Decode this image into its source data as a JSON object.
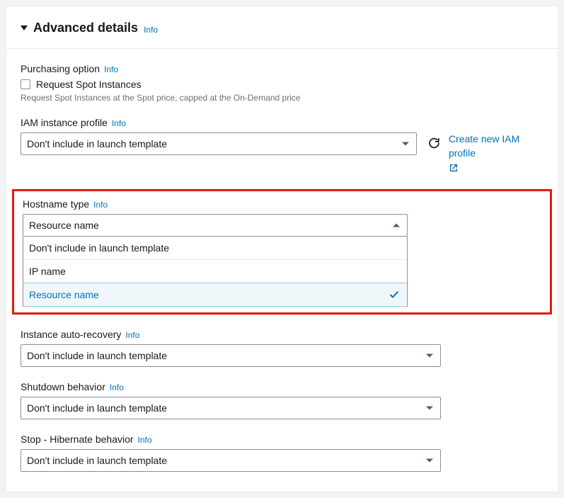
{
  "section": {
    "title": "Advanced details",
    "info": "Info"
  },
  "purchasing": {
    "label": "Purchasing option",
    "info": "Info",
    "checkbox_label": "Request Spot Instances",
    "helper": "Request Spot Instances at the Spot price, capped at the On-Demand price"
  },
  "iam": {
    "label": "IAM instance profile",
    "info": "Info",
    "value": "Don't include in launch template",
    "link": "Create new IAM profile"
  },
  "hostname": {
    "label": "Hostname type",
    "info": "Info",
    "value": "Resource name",
    "options": [
      "Don't include in launch template",
      "IP name",
      "Resource name"
    ]
  },
  "autorecovery": {
    "label": "Instance auto-recovery",
    "info": "Info",
    "value": "Don't include in launch template"
  },
  "shutdown": {
    "label": "Shutdown behavior",
    "info": "Info",
    "value": "Don't include in launch template"
  },
  "hibernate": {
    "label": "Stop - Hibernate behavior",
    "info": "Info",
    "value": "Don't include in launch template"
  }
}
